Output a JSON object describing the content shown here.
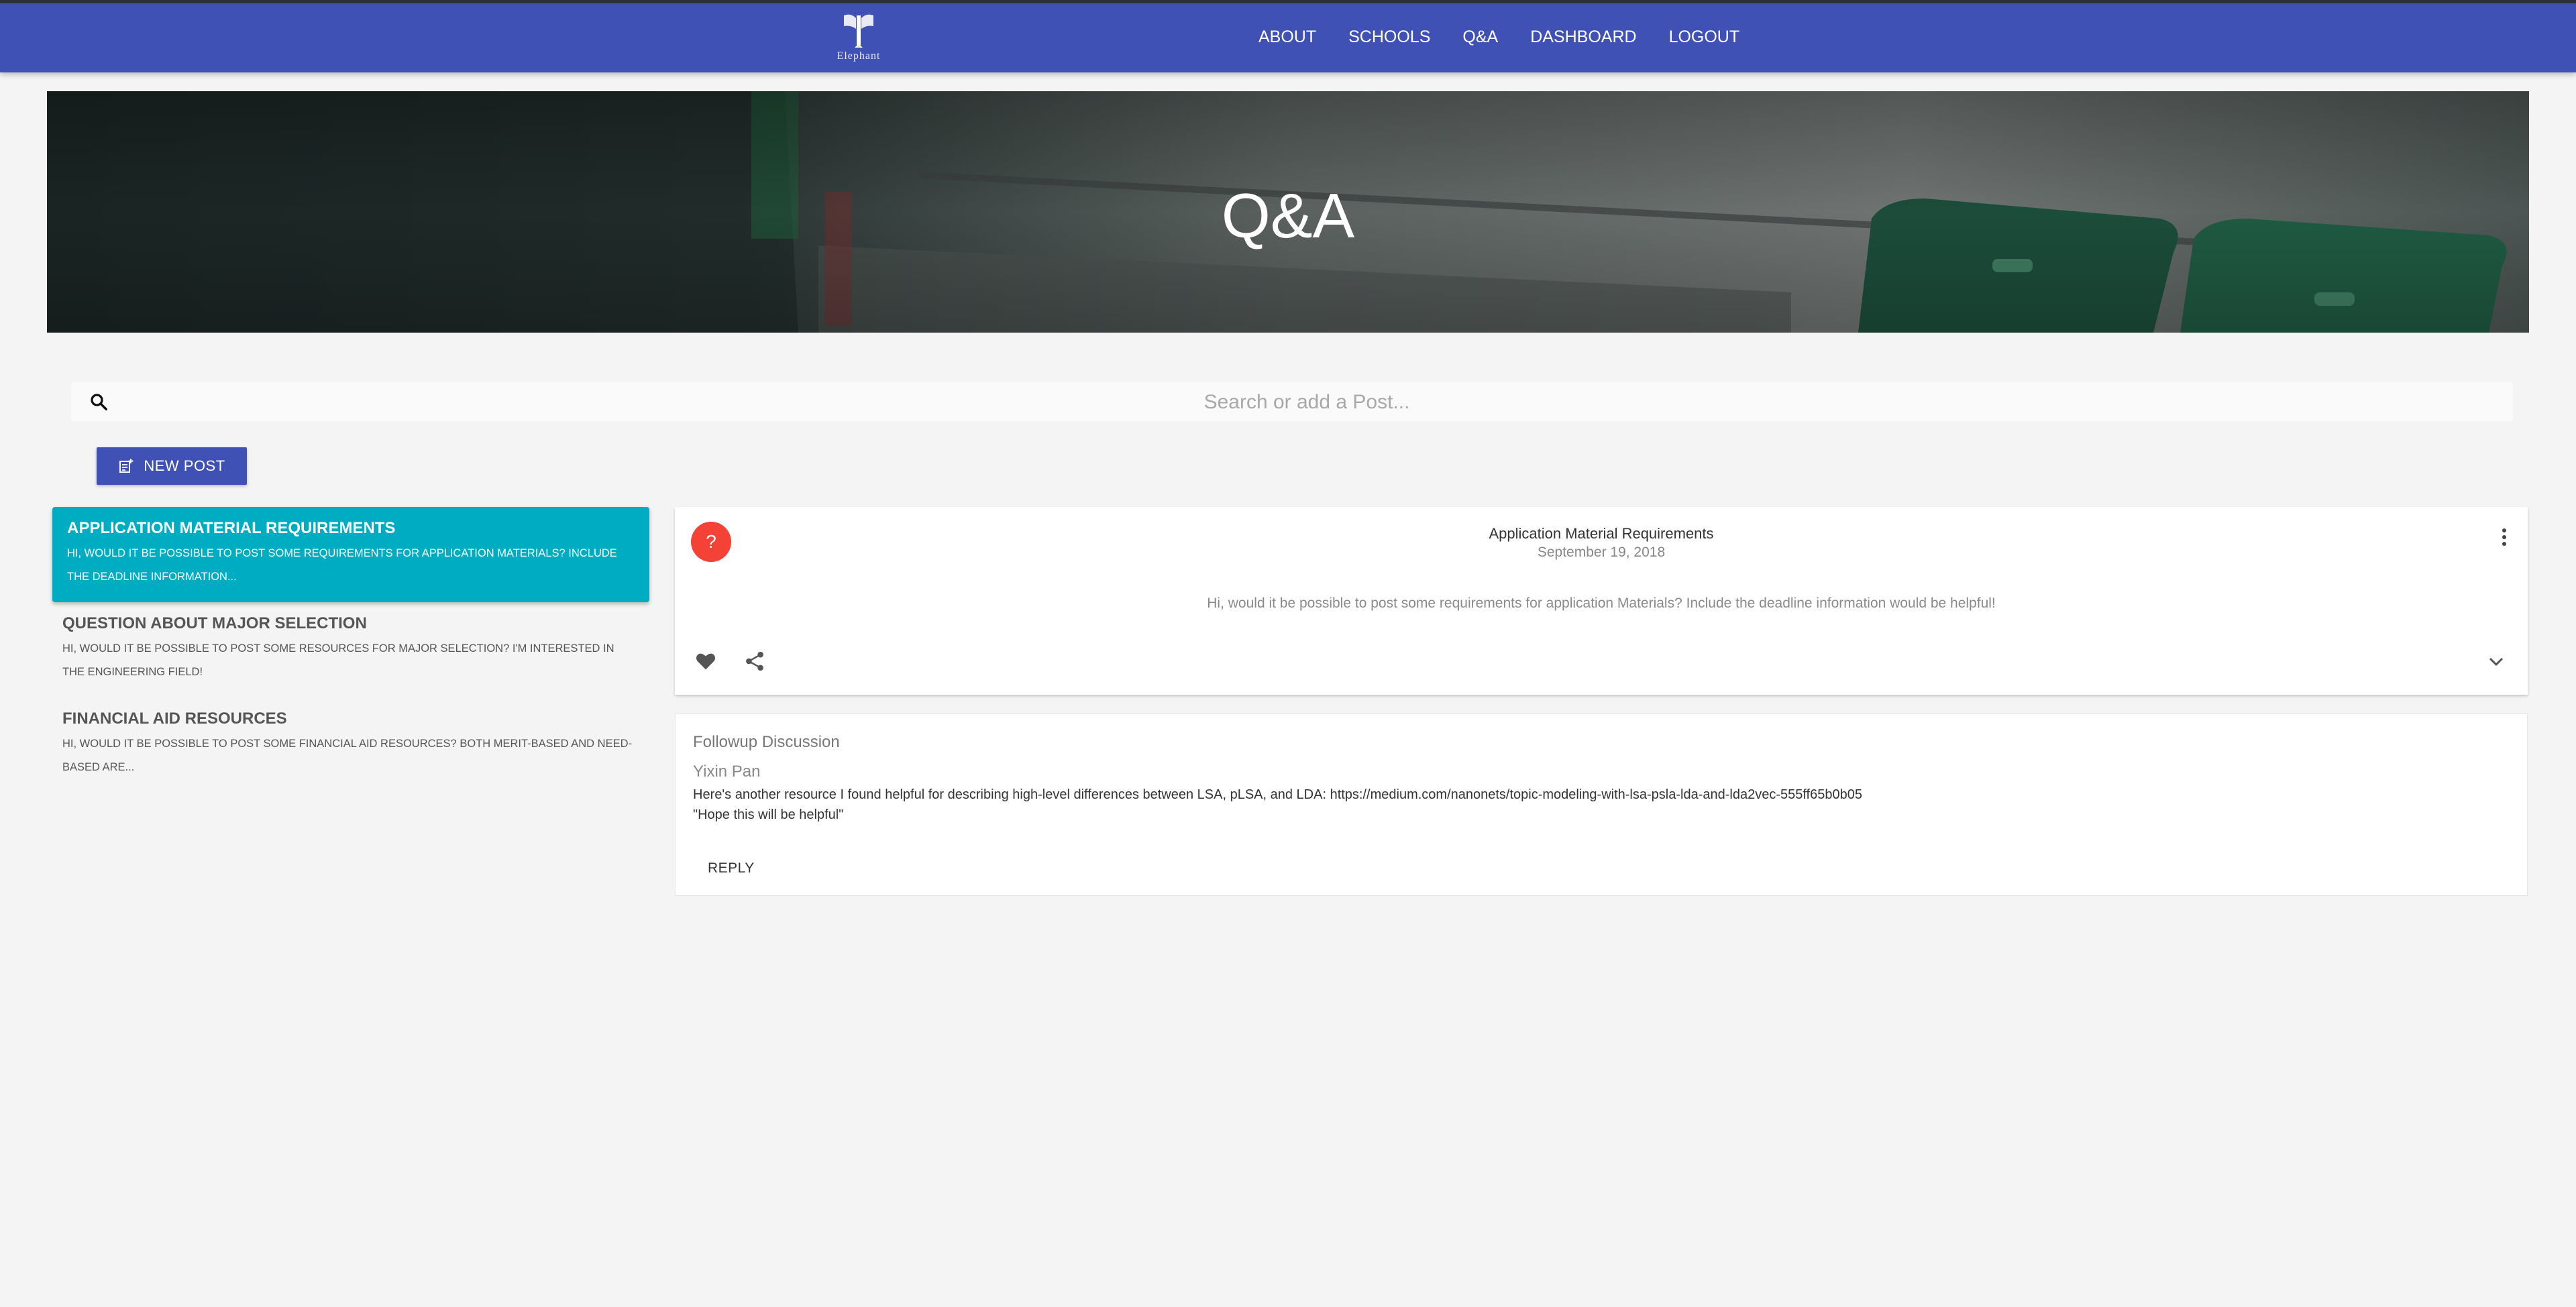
{
  "header": {
    "logo_text": "Elephant",
    "nav": [
      "ABOUT",
      "SCHOOLS",
      "Q&A",
      "DASHBOARD",
      "LOGOUT"
    ],
    "color": "#3f51b5"
  },
  "hero": {
    "title": "Q&A"
  },
  "search": {
    "placeholder": "Search or add a Post...",
    "icon": "search-icon"
  },
  "new_post": {
    "label": "NEW POST",
    "icon": "post-add-icon"
  },
  "posts": [
    {
      "title": "APPLICATION MATERIAL REQUIREMENTS",
      "snippet": "Hi, would it be possible to post some requirements for application Materials? Include the deadline information...",
      "active": true
    },
    {
      "title": "QUESTION ABOUT MAJOR SELECTION",
      "snippet": "Hi, would it be possible to post some resources for major selection? I'm interested in the engineering field!",
      "active": false
    },
    {
      "title": "FINANCIAL AID RESOURCES",
      "snippet": "Hi, would it be possible to post some financial aid resources? Both merit-based and need-based are...",
      "active": false
    }
  ],
  "selected_post": {
    "avatar": "?",
    "title": "Application Material Requirements",
    "date": "September 19, 2018",
    "body": "Hi, would it be possible to post some requirements for application Materials? Include the deadline information would be helpful!",
    "actions": [
      "heart-icon",
      "share-icon",
      "more-vert-icon",
      "expand-more-icon"
    ],
    "avatar_color": "#f44336"
  },
  "followup": {
    "heading": "Followup Discussion",
    "author": "Yixin Pan",
    "line1": "Here's another resource I found helpful for describing high-level differences between LSA, pLSA, and LDA:  https://medium.com/nanonets/topic-modeling-with-lsa-psla-lda-and-lda2vec-555ff65b0b05",
    "line2": "\"Hope this will be helpful\"",
    "reply_label": "REPLY"
  },
  "colors": {
    "active_post": "#00acc1",
    "background": "#f4f4f4"
  }
}
